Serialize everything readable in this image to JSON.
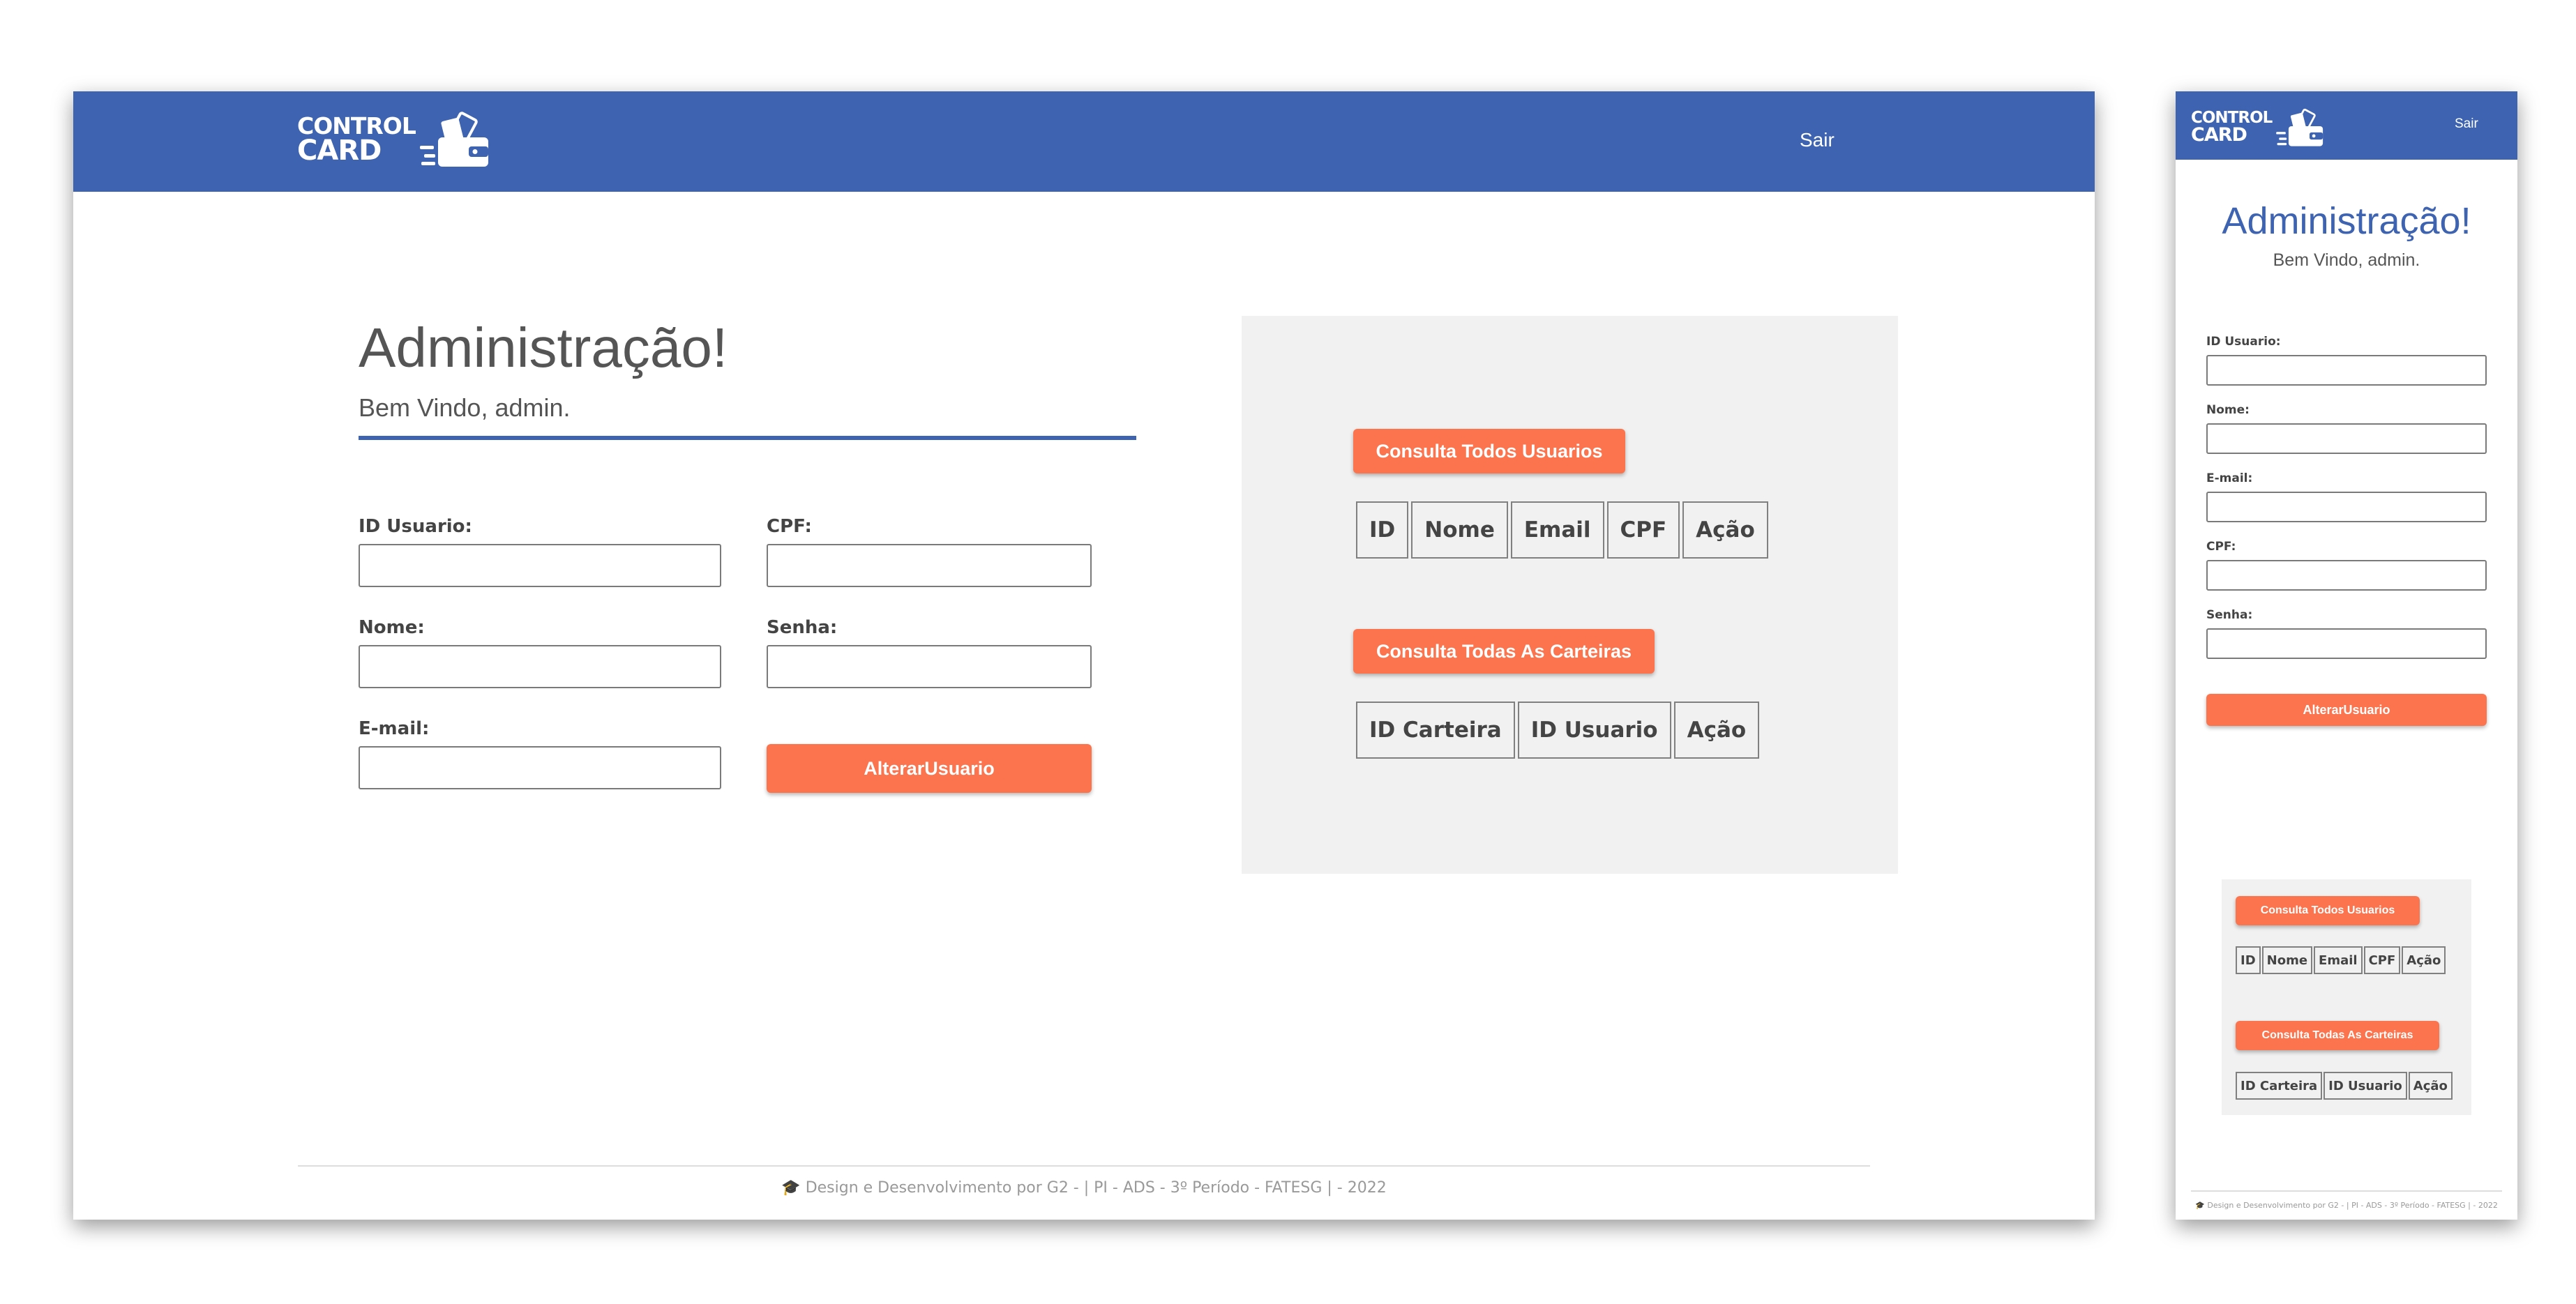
{
  "brand": {
    "line1": "CONTROL",
    "line2": "CARD",
    "color": "#3d63b1",
    "accent": "#fc744e",
    "icon": "wallet-card-icon"
  },
  "nav": {
    "logout_label": "Sair"
  },
  "header": {
    "title": "Administração!",
    "subtitle": "Bem Vindo, admin."
  },
  "form": {
    "id_label": "ID Usuario:",
    "cpf_label": "CPF:",
    "name_label": "Nome:",
    "password_label": "Senha:",
    "email_label": "E-mail:",
    "submit_label": "AlterarUsuario"
  },
  "panel": {
    "users_button": "Consulta Todos Usuarios",
    "users_columns": [
      "ID",
      "Nome",
      "Email",
      "CPF",
      "Ação"
    ],
    "wallets_button": "Consulta Todas As Carteiras",
    "wallets_columns": [
      "ID Carteira",
      "ID Usuario",
      "Ação"
    ]
  },
  "footer": {
    "icon": "graduation-cap-icon",
    "text": "Design e Desenvolvimento por G2 - | PI - ADS - 3º Período - FATESG | - 2022"
  }
}
